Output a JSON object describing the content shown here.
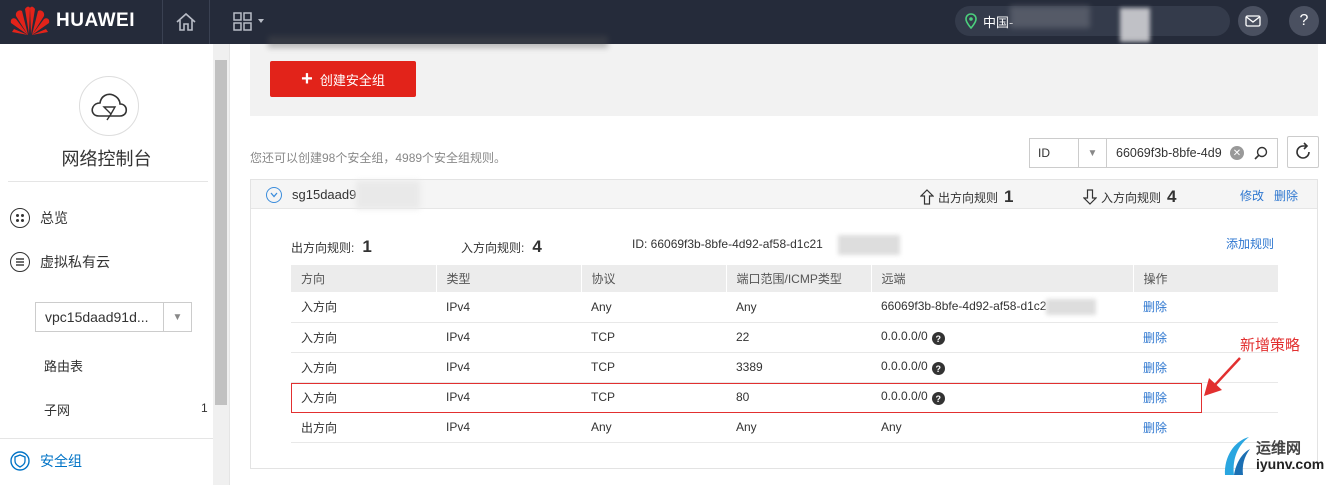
{
  "header": {
    "brand": "HUAWEI",
    "region": "中国-",
    "colors": {
      "bar": "#252b3a",
      "brand_red": "#e2231a"
    }
  },
  "sidebar": {
    "title": "网络控制台",
    "nav": [
      {
        "label": "总览",
        "icon": "grid-icon"
      },
      {
        "label": "虚拟私有云",
        "icon": "list-icon"
      }
    ],
    "vpc_select": "vpc15daad91d...",
    "sub_items": [
      {
        "label": "路由表"
      },
      {
        "label": "子网",
        "count": "1"
      }
    ],
    "active": {
      "label": "安全组",
      "icon": "shield-icon"
    }
  },
  "main": {
    "create_button": "创建安全组",
    "quota_text": "您还可以创建98个安全组，4989个安全组规则。",
    "search": {
      "field": "ID",
      "value": "66069f3b-8bfe-4d9"
    },
    "group": {
      "name": "sg15daad9",
      "outbound_label": "出方向规则",
      "outbound_count": "1",
      "inbound_label": "入方向规则",
      "inbound_count": "4",
      "edit": "修改",
      "delete": "删除",
      "summary": {
        "outbound_label": "出方向规则:",
        "outbound_count": "1",
        "inbound_label": "入方向规则:",
        "inbound_count": "4",
        "id_text": "ID: 66069f3b-8bfe-4d92-af58-d1c21"
      },
      "add_rule": "添加规则",
      "columns": [
        "方向",
        "类型",
        "协议",
        "端口范围/ICMP类型",
        "远端",
        "操作"
      ],
      "rows": [
        {
          "direction": "入方向",
          "type": "IPv4",
          "protocol": "Any",
          "port": "Any",
          "remote": "66069f3b-8bfe-4d92-af58-d1c2",
          "action": "删除",
          "help": false,
          "blur": true
        },
        {
          "direction": "入方向",
          "type": "IPv4",
          "protocol": "TCP",
          "port": "22",
          "remote": "0.0.0.0/0",
          "action": "删除",
          "help": true,
          "blur": false
        },
        {
          "direction": "入方向",
          "type": "IPv4",
          "protocol": "TCP",
          "port": "3389",
          "remote": "0.0.0.0/0",
          "action": "删除",
          "help": true,
          "blur": false
        },
        {
          "direction": "入方向",
          "type": "IPv4",
          "protocol": "TCP",
          "port": "80",
          "remote": "0.0.0.0/0",
          "action": "删除",
          "help": true,
          "blur": false
        },
        {
          "direction": "出方向",
          "type": "IPv4",
          "protocol": "Any",
          "port": "Any",
          "remote": "Any",
          "action": "删除",
          "help": false,
          "blur": false
        }
      ]
    }
  },
  "annotation": {
    "text": "新增策略",
    "color": "#e23030"
  },
  "watermark": {
    "cn": "运维网",
    "en": "iyunv.com"
  }
}
